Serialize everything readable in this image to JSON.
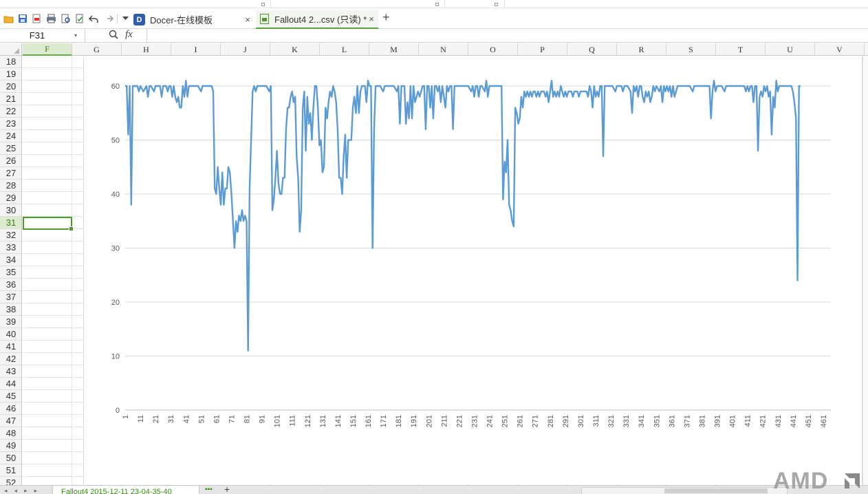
{
  "toolbar": {
    "icons": [
      "open-folder-icon",
      "save-icon",
      "export-pdf-icon",
      "print-icon",
      "print-preview-icon",
      "spell-check-icon",
      "undo-icon",
      "redo-icon",
      "more-dropdown-icon"
    ]
  },
  "tabs": [
    {
      "label": "Docer-在线模板",
      "close": "×"
    },
    {
      "label": "Fallout4 2...csv (只读) *",
      "close": "×"
    }
  ],
  "new_tab": "+",
  "formula_bar": {
    "name_box": "F31",
    "fx": "fx",
    "value": ""
  },
  "columns": [
    "F",
    "G",
    "H",
    "I",
    "J",
    "K",
    "L",
    "M",
    "N",
    "O",
    "P",
    "Q",
    "R",
    "S",
    "T",
    "U",
    "V"
  ],
  "active_column": "F",
  "rows": [
    "18",
    "19",
    "20",
    "21",
    "22",
    "23",
    "24",
    "25",
    "26",
    "27",
    "28",
    "29",
    "30",
    "31",
    "32",
    "33",
    "34",
    "35",
    "36",
    "37",
    "38",
    "39",
    "40",
    "41",
    "42",
    "43",
    "44",
    "45",
    "46",
    "47",
    "48",
    "49",
    "50",
    "51",
    "52"
  ],
  "active_row": "31",
  "sheet_tab": "Fallout4 2015-12-11 23-04-35-40",
  "sheet_more": "▪▪▪",
  "sheet_add": "+",
  "watermark": "AMD",
  "chart_data": {
    "type": "line",
    "title": "",
    "xlabel": "",
    "ylabel": "",
    "ylim": [
      0,
      60
    ],
    "yticks": [
      0,
      10,
      20,
      30,
      40,
      50,
      60
    ],
    "xticks": [
      1,
      11,
      21,
      31,
      41,
      51,
      61,
      71,
      81,
      91,
      101,
      111,
      121,
      131,
      141,
      151,
      161,
      171,
      181,
      191,
      201,
      211,
      221,
      231,
      241,
      251,
      261,
      271,
      281,
      291,
      301,
      311,
      321,
      331,
      341,
      351,
      361,
      371,
      381,
      391,
      401,
      411,
      421,
      431,
      441,
      451,
      461
    ],
    "x_count": 466,
    "grid": "horizontal",
    "legend": "none",
    "line_color": "#5b9bd5",
    "series_keypoints": [
      [
        1,
        60
      ],
      [
        2,
        60
      ],
      [
        3,
        51
      ],
      [
        4,
        60
      ],
      [
        5,
        38
      ],
      [
        6,
        60
      ],
      [
        7,
        60
      ],
      [
        9,
        60
      ],
      [
        10,
        59
      ],
      [
        11,
        60
      ],
      [
        13,
        59
      ],
      [
        15,
        60
      ],
      [
        16,
        58
      ],
      [
        17,
        60
      ],
      [
        18,
        60
      ],
      [
        20,
        59
      ],
      [
        21,
        60
      ],
      [
        22,
        60
      ],
      [
        24,
        60
      ],
      [
        25,
        58
      ],
      [
        26,
        60
      ],
      [
        28,
        60
      ],
      [
        29,
        59
      ],
      [
        30,
        60
      ],
      [
        31,
        60
      ],
      [
        32,
        58
      ],
      [
        33,
        60
      ],
      [
        34,
        58
      ],
      [
        35,
        57
      ],
      [
        36,
        58
      ],
      [
        37,
        56
      ],
      [
        38,
        56
      ],
      [
        39,
        60
      ],
      [
        40,
        58
      ],
      [
        41,
        61
      ],
      [
        42,
        58
      ],
      [
        43,
        60
      ],
      [
        45,
        60
      ],
      [
        47,
        60
      ],
      [
        49,
        60
      ],
      [
        51,
        59
      ],
      [
        52,
        60
      ],
      [
        54,
        60
      ],
      [
        56,
        60
      ],
      [
        58,
        60
      ],
      [
        59,
        59
      ],
      [
        60,
        41
      ],
      [
        61,
        40
      ],
      [
        62,
        45
      ],
      [
        63,
        41
      ],
      [
        64,
        38
      ],
      [
        65,
        44
      ],
      [
        66,
        38
      ],
      [
        67,
        41
      ],
      [
        68,
        41
      ],
      [
        69,
        45
      ],
      [
        70,
        44
      ],
      [
        71,
        40
      ],
      [
        72,
        35
      ],
      [
        73,
        30
      ],
      [
        74,
        35
      ],
      [
        75,
        33
      ],
      [
        76,
        36
      ],
      [
        77,
        35
      ],
      [
        78,
        37
      ],
      [
        79,
        35
      ],
      [
        80,
        36
      ],
      [
        81,
        35
      ],
      [
        82,
        11
      ],
      [
        83,
        41
      ],
      [
        84,
        50
      ],
      [
        85,
        59
      ],
      [
        86,
        60
      ],
      [
        87,
        59
      ],
      [
        88,
        60
      ],
      [
        90,
        60
      ],
      [
        92,
        60
      ],
      [
        94,
        60
      ],
      [
        96,
        59
      ],
      [
        97,
        60
      ],
      [
        98,
        37
      ],
      [
        99,
        39
      ],
      [
        100,
        43
      ],
      [
        101,
        48
      ],
      [
        102,
        42
      ],
      [
        103,
        40
      ],
      [
        104,
        40
      ],
      [
        105,
        43
      ],
      [
        106,
        43
      ],
      [
        107,
        52
      ],
      [
        108,
        56
      ],
      [
        109,
        56
      ],
      [
        110,
        58
      ],
      [
        111,
        59
      ],
      [
        112,
        57
      ],
      [
        113,
        58
      ],
      [
        114,
        47
      ],
      [
        115,
        43
      ],
      [
        116,
        33
      ],
      [
        117,
        37
      ],
      [
        118,
        56
      ],
      [
        119,
        59
      ],
      [
        120,
        48
      ],
      [
        121,
        58
      ],
      [
        122,
        53
      ],
      [
        123,
        55
      ],
      [
        124,
        50
      ],
      [
        125,
        56
      ],
      [
        126,
        60
      ],
      [
        127,
        60
      ],
      [
        128,
        56
      ],
      [
        129,
        49
      ],
      [
        130,
        50
      ],
      [
        131,
        44
      ],
      [
        132,
        45
      ],
      [
        133,
        56
      ],
      [
        134,
        54
      ],
      [
        135,
        57
      ],
      [
        136,
        59
      ],
      [
        137,
        58
      ],
      [
        138,
        60
      ],
      [
        139,
        59
      ],
      [
        140,
        57
      ],
      [
        141,
        52
      ],
      [
        142,
        43
      ],
      [
        143,
        43
      ],
      [
        144,
        40
      ],
      [
        145,
        47
      ],
      [
        146,
        51
      ],
      [
        147,
        43
      ],
      [
        148,
        50
      ],
      [
        149,
        50
      ],
      [
        150,
        50
      ],
      [
        151,
        56
      ],
      [
        152,
        58
      ],
      [
        153,
        55
      ],
      [
        154,
        60
      ],
      [
        155,
        55
      ],
      [
        156,
        59
      ],
      [
        157,
        60
      ],
      [
        158,
        60
      ],
      [
        159,
        60
      ],
      [
        160,
        57
      ],
      [
        161,
        61
      ],
      [
        162,
        60
      ],
      [
        163,
        60
      ],
      [
        164,
        30
      ],
      [
        165,
        52
      ],
      [
        166,
        60
      ],
      [
        167,
        60
      ],
      [
        169,
        60
      ],
      [
        171,
        59
      ],
      [
        172,
        60
      ],
      [
        174,
        60
      ],
      [
        176,
        60
      ],
      [
        178,
        60
      ],
      [
        180,
        59
      ],
      [
        181,
        60
      ],
      [
        182,
        53
      ],
      [
        183,
        60
      ],
      [
        184,
        60
      ],
      [
        185,
        60
      ],
      [
        186,
        53
      ],
      [
        187,
        57
      ],
      [
        188,
        54
      ],
      [
        189,
        60
      ],
      [
        190,
        54
      ],
      [
        191,
        60
      ],
      [
        192,
        57
      ],
      [
        193,
        58
      ],
      [
        194,
        59
      ],
      [
        195,
        58
      ],
      [
        196,
        59
      ],
      [
        197,
        60
      ],
      [
        198,
        60
      ],
      [
        199,
        52
      ],
      [
        200,
        60
      ],
      [
        201,
        60
      ],
      [
        202,
        56
      ],
      [
        203,
        60
      ],
      [
        204,
        54
      ],
      [
        205,
        60
      ],
      [
        206,
        60
      ],
      [
        207,
        59
      ],
      [
        208,
        60
      ],
      [
        209,
        57
      ],
      [
        210,
        60
      ],
      [
        211,
        58
      ],
      [
        212,
        56
      ],
      [
        213,
        60
      ],
      [
        214,
        59
      ],
      [
        215,
        60
      ],
      [
        216,
        60
      ],
      [
        217,
        52
      ],
      [
        218,
        60
      ],
      [
        219,
        60
      ],
      [
        221,
        60
      ],
      [
        223,
        60
      ],
      [
        225,
        60
      ],
      [
        227,
        60
      ],
      [
        229,
        59
      ],
      [
        230,
        60
      ],
      [
        231,
        58
      ],
      [
        232,
        60
      ],
      [
        233,
        60
      ],
      [
        234,
        58
      ],
      [
        235,
        60
      ],
      [
        236,
        60
      ],
      [
        238,
        59
      ],
      [
        239,
        61
      ],
      [
        240,
        58
      ],
      [
        241,
        60
      ],
      [
        243,
        60
      ],
      [
        245,
        60
      ],
      [
        247,
        60
      ],
      [
        249,
        60
      ],
      [
        250,
        39
      ],
      [
        251,
        46
      ],
      [
        252,
        44
      ],
      [
        253,
        50
      ],
      [
        254,
        38
      ],
      [
        255,
        37
      ],
      [
        256,
        35
      ],
      [
        257,
        34
      ],
      [
        258,
        56
      ],
      [
        259,
        55
      ],
      [
        260,
        53
      ],
      [
        261,
        54
      ],
      [
        262,
        58
      ],
      [
        263,
        56
      ],
      [
        264,
        59
      ],
      [
        265,
        58
      ],
      [
        266,
        59
      ],
      [
        267,
        58
      ],
      [
        268,
        59
      ],
      [
        269,
        58
      ],
      [
        270,
        59
      ],
      [
        271,
        59
      ],
      [
        272,
        58
      ],
      [
        273,
        59
      ],
      [
        274,
        58
      ],
      [
        275,
        59
      ],
      [
        277,
        59
      ],
      [
        278,
        58
      ],
      [
        279,
        59
      ],
      [
        280,
        57
      ],
      [
        281,
        59
      ],
      [
        282,
        61
      ],
      [
        283,
        58
      ],
      [
        284,
        59
      ],
      [
        285,
        58
      ],
      [
        286,
        59
      ],
      [
        287,
        58
      ],
      [
        288,
        60
      ],
      [
        289,
        59
      ],
      [
        290,
        58
      ],
      [
        291,
        59
      ],
      [
        292,
        58
      ],
      [
        293,
        59
      ],
      [
        295,
        59
      ],
      [
        296,
        58
      ],
      [
        297,
        59
      ],
      [
        299,
        59
      ],
      [
        300,
        58
      ],
      [
        301,
        59
      ],
      [
        303,
        59
      ],
      [
        305,
        59
      ],
      [
        306,
        58
      ],
      [
        307,
        60
      ],
      [
        308,
        59
      ],
      [
        309,
        56
      ],
      [
        310,
        60
      ],
      [
        311,
        58
      ],
      [
        312,
        59
      ],
      [
        313,
        58
      ],
      [
        314,
        60
      ],
      [
        315,
        60
      ],
      [
        316,
        47
      ],
      [
        317,
        60
      ],
      [
        318,
        60
      ],
      [
        320,
        60
      ],
      [
        322,
        60
      ],
      [
        324,
        59
      ],
      [
        325,
        60
      ],
      [
        326,
        60
      ],
      [
        328,
        60
      ],
      [
        329,
        59
      ],
      [
        330,
        60
      ],
      [
        332,
        60
      ],
      [
        334,
        59
      ],
      [
        335,
        55
      ],
      [
        336,
        60
      ],
      [
        337,
        59
      ],
      [
        338,
        60
      ],
      [
        339,
        58
      ],
      [
        340,
        60
      ],
      [
        341,
        60
      ],
      [
        342,
        58
      ],
      [
        343,
        57
      ],
      [
        344,
        59
      ],
      [
        345,
        58
      ],
      [
        346,
        59
      ],
      [
        347,
        57
      ],
      [
        348,
        58
      ],
      [
        349,
        60
      ],
      [
        350,
        59
      ],
      [
        351,
        60
      ],
      [
        353,
        59
      ],
      [
        354,
        60
      ],
      [
        355,
        57
      ],
      [
        356,
        60
      ],
      [
        357,
        59
      ],
      [
        358,
        60
      ],
      [
        359,
        59
      ],
      [
        360,
        60
      ],
      [
        361,
        58
      ],
      [
        362,
        60
      ],
      [
        363,
        58
      ],
      [
        364,
        59
      ],
      [
        365,
        60
      ],
      [
        367,
        60
      ],
      [
        369,
        60
      ],
      [
        371,
        60
      ],
      [
        373,
        60
      ],
      [
        375,
        59
      ],
      [
        376,
        60
      ],
      [
        378,
        60
      ],
      [
        380,
        60
      ],
      [
        382,
        60
      ],
      [
        384,
        60
      ],
      [
        386,
        60
      ],
      [
        387,
        54
      ],
      [
        388,
        59
      ],
      [
        389,
        61
      ],
      [
        390,
        59
      ],
      [
        391,
        60
      ],
      [
        392,
        60
      ],
      [
        394,
        60
      ],
      [
        396,
        59
      ],
      [
        397,
        60
      ],
      [
        399,
        60
      ],
      [
        401,
        60
      ],
      [
        403,
        60
      ],
      [
        405,
        60
      ],
      [
        407,
        60
      ],
      [
        409,
        60
      ],
      [
        410,
        59
      ],
      [
        411,
        60
      ],
      [
        412,
        59
      ],
      [
        413,
        60
      ],
      [
        414,
        60
      ],
      [
        415,
        57
      ],
      [
        416,
        60
      ],
      [
        417,
        60
      ],
      [
        418,
        48
      ],
      [
        419,
        58
      ],
      [
        420,
        59
      ],
      [
        421,
        58
      ],
      [
        422,
        60
      ],
      [
        423,
        59
      ],
      [
        424,
        60
      ],
      [
        425,
        58
      ],
      [
        426,
        59
      ],
      [
        427,
        51
      ],
      [
        428,
        58
      ],
      [
        429,
        56
      ],
      [
        430,
        61
      ],
      [
        431,
        59
      ],
      [
        432,
        60
      ],
      [
        434,
        60
      ],
      [
        436,
        60
      ],
      [
        438,
        60
      ],
      [
        440,
        60
      ],
      [
        441,
        59
      ],
      [
        442,
        57
      ],
      [
        443,
        54
      ],
      [
        444,
        24
      ],
      [
        445,
        60
      ],
      [
        446,
        60
      ]
    ]
  }
}
